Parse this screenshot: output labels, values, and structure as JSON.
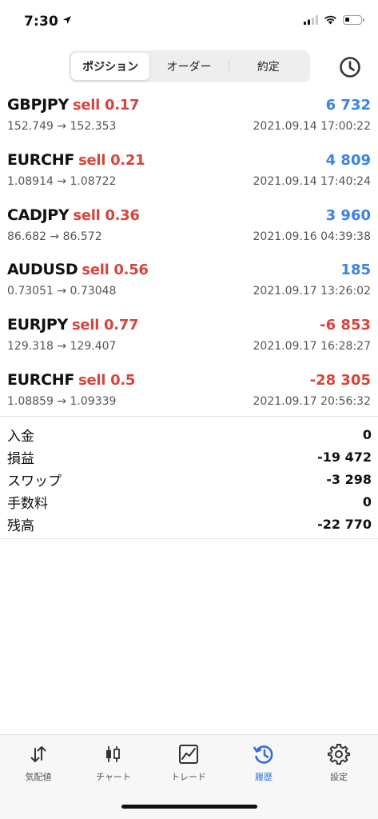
{
  "status_bar": {
    "time": "7:30",
    "icons": [
      "location-arrow-icon",
      "cellular-signal-icon",
      "wifi-icon",
      "battery-icon"
    ]
  },
  "header": {
    "tabs": [
      {
        "label": "ポジション",
        "active": true
      },
      {
        "label": "オーダー",
        "active": false
      },
      {
        "label": "約定",
        "active": false
      }
    ],
    "history_icon": "clock-icon"
  },
  "positions": [
    {
      "symbol": "GBPJPY",
      "trade": "sell 0.17",
      "profit": "6 732",
      "prices": "152.749 → 152.353",
      "time": "2021.09.14 17:00:22"
    },
    {
      "symbol": "EURCHF",
      "trade": "sell 0.21",
      "profit": "4 809",
      "prices": "1.08914 → 1.08722",
      "time": "2021.09.14 17:40:24"
    },
    {
      "symbol": "CADJPY",
      "trade": "sell 0.36",
      "profit": "3 960",
      "prices": "86.682 → 86.572",
      "time": "2021.09.16 04:39:38"
    },
    {
      "symbol": "AUDUSD",
      "trade": "sell 0.56",
      "profit": "185",
      "prices": "0.73051 → 0.73048",
      "time": "2021.09.17 13:26:02"
    },
    {
      "symbol": "EURJPY",
      "trade": "sell 0.77",
      "profit": "-6 853",
      "prices": "129.318 → 129.407",
      "time": "2021.09.17 16:28:27"
    },
    {
      "symbol": "EURCHF",
      "trade": "sell 0.5",
      "profit": "-28 305",
      "prices": "1.08859 → 1.09339",
      "time": "2021.09.17 20:56:32"
    }
  ],
  "summary": [
    {
      "label": "入金",
      "value": "0"
    },
    {
      "label": "損益",
      "value": "-19 472"
    },
    {
      "label": "スワップ",
      "value": "-3 298"
    },
    {
      "label": "手数料",
      "value": "0"
    },
    {
      "label": "残高",
      "value": "-22 770"
    }
  ],
  "tabbar": [
    {
      "label": "気配値",
      "icon": "quotes-arrows-icon",
      "active": false
    },
    {
      "label": "チャート",
      "icon": "candlestick-chart-icon",
      "active": false
    },
    {
      "label": "トレード",
      "icon": "trade-chart-icon",
      "active": false
    },
    {
      "label": "履歴",
      "icon": "history-icon",
      "active": true
    },
    {
      "label": "設定",
      "icon": "gear-icon",
      "active": false
    }
  ],
  "colors": {
    "sell": "#d8443c",
    "profit_positive": "#3a82e6",
    "profit_negative": "#d8443c",
    "tab_active": "#2f6fd6"
  }
}
